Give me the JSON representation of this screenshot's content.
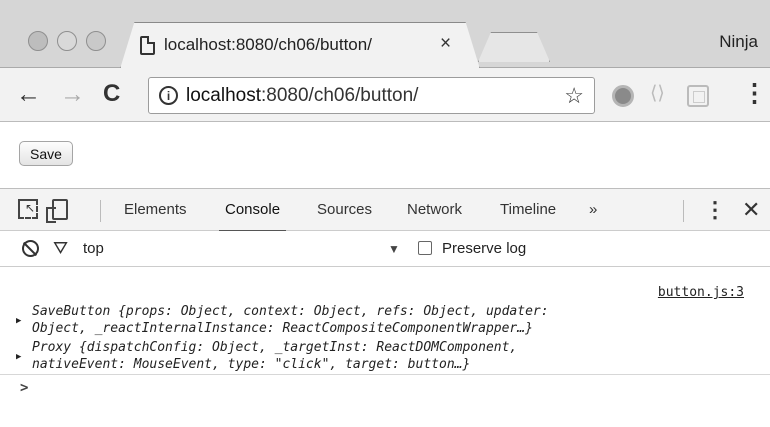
{
  "window": {
    "profile_name": "Ninja"
  },
  "tab": {
    "title": "localhost:8080/ch06/button/",
    "close_glyph": "×"
  },
  "toolbar": {
    "back_glyph": "←",
    "forward_glyph": "→",
    "reload_glyph": "C",
    "info_glyph": "i",
    "url_host": "localhost",
    "url_path": ":8080/ch06/button/",
    "star_glyph": "☆",
    "menu_glyph": "⋮"
  },
  "page": {
    "save_label": "Save"
  },
  "devtools": {
    "tabs": [
      {
        "label": "Elements"
      },
      {
        "label": "Console"
      },
      {
        "label": "Sources"
      },
      {
        "label": "Network"
      },
      {
        "label": "Timeline"
      },
      {
        "label": "»"
      }
    ],
    "active_tab": "Console",
    "menu_glyph": "⋮",
    "close_glyph": "✕",
    "context": "top",
    "context_arrow": "▼",
    "preserve_log_label": "Preserve log",
    "filter_glyph": "⛛",
    "source_link": "button.js:3",
    "log_entries": [
      {
        "arrow": "▶",
        "line1": "SaveButton {props: Object, context: Object, refs: Object, updater:",
        "line2": "Object, _reactInternalInstance: ReactCompositeComponentWrapper…}"
      },
      {
        "arrow": "▶",
        "line1": "Proxy {dispatchConfig: Object, _targetInst: ReactDOMComponent,",
        "line2": "nativeEvent: MouseEvent, type: \"click\", target: button…}"
      }
    ],
    "prompt_glyph": ">"
  },
  "colors": {
    "titlebar": "#d6d6d6",
    "toolbar": "#f2f2f2",
    "devtools_bar": "#f3f3f3"
  }
}
